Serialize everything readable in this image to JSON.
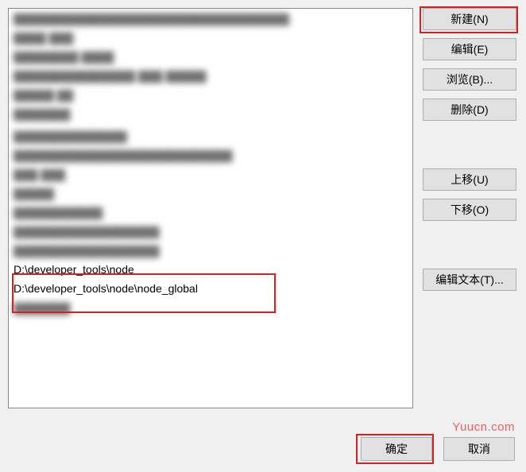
{
  "list": {
    "blurred": [
      "▓▓▓▓▓▓▓▓▓▓▓▓▓▓▓▓▓▓▓▓▓▓▓▓▓▓▓▓▓▓▓▓▓▓",
      "▓▓▓▓ ▓▓▓",
      "▓▓▓▓▓▓▓▓ ▓▓▓▓",
      "▓▓▓▓▓▓▓▓▓▓▓▓▓▓▓ ▓▓▓ ▓▓▓▓▓",
      "▓▓▓▓▓ ▓▓",
      "▓▓▓▓▓▓▓",
      "",
      "▓▓▓▓▓▓▓▓▓▓▓▓▓▓",
      "▓▓▓▓▓▓▓▓▓▓▓▓▓▓▓▓▓▓▓▓▓▓▓▓▓▓▓",
      "▓▓▓ ▓▓▓",
      "▓▓▓▓▓",
      "▓▓▓▓▓▓▓▓▓▓▓",
      "▓▓▓▓▓▓▓▓▓▓▓▓▓▓▓▓▓▓",
      "▓▓▓▓▓▓▓▓▓▓▓▓▓▓▓▓▓▓"
    ],
    "visible": [
      "D:\\developer_tools\\node",
      "D:\\developer_tools\\node\\node_global"
    ],
    "blurred_after": [
      "▓▓▓▓▓▓▓"
    ]
  },
  "buttons": {
    "new": "新建(N)",
    "edit": "编辑(E)",
    "browse": "浏览(B)...",
    "delete": "删除(D)",
    "moveUp": "上移(U)",
    "moveDown": "下移(O)",
    "editText": "编辑文本(T)..."
  },
  "bottom": {
    "ok": "确定",
    "cancel": "取消"
  },
  "watermark": "Yuucn.com"
}
